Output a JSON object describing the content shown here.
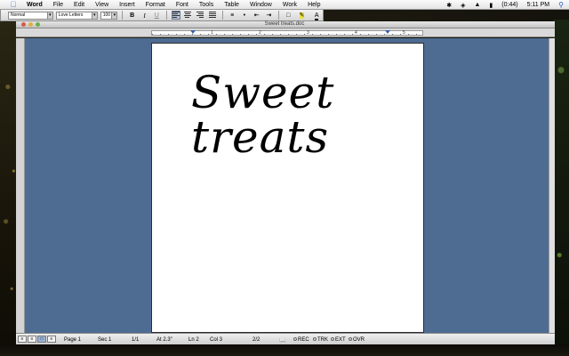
{
  "menubar": {
    "app_name": "Word",
    "items": [
      "File",
      "Edit",
      "View",
      "Insert",
      "Format",
      "Font",
      "Tools",
      "Table",
      "Window",
      "Work",
      "Help"
    ],
    "battery": "(0:44)",
    "clock": "5:11 PM"
  },
  "toolbar": {
    "style_value": "Normal",
    "font_value": "Love Letters",
    "size_value": "100",
    "bold": "B",
    "italic": "I",
    "underline": "U"
  },
  "window": {
    "title": "Sweet treats.doc"
  },
  "ruler": {
    "labels": [
      "1",
      "2",
      "3",
      "4",
      "5"
    ]
  },
  "document": {
    "line1": "Sweet",
    "line2": "treats"
  },
  "status": {
    "page": "Page  1",
    "sec": "Sec  1",
    "page_of": "1/1",
    "at": "At  2.3\"",
    "ln": "Ln  2",
    "col": "Col  3",
    "words": "2/2",
    "rec": "REC",
    "trk": "TRK",
    "ext": "EXT",
    "ovr": "OVR"
  },
  "colors": {
    "workspace": "#4e6c92",
    "accent": "#3a6fd0"
  }
}
